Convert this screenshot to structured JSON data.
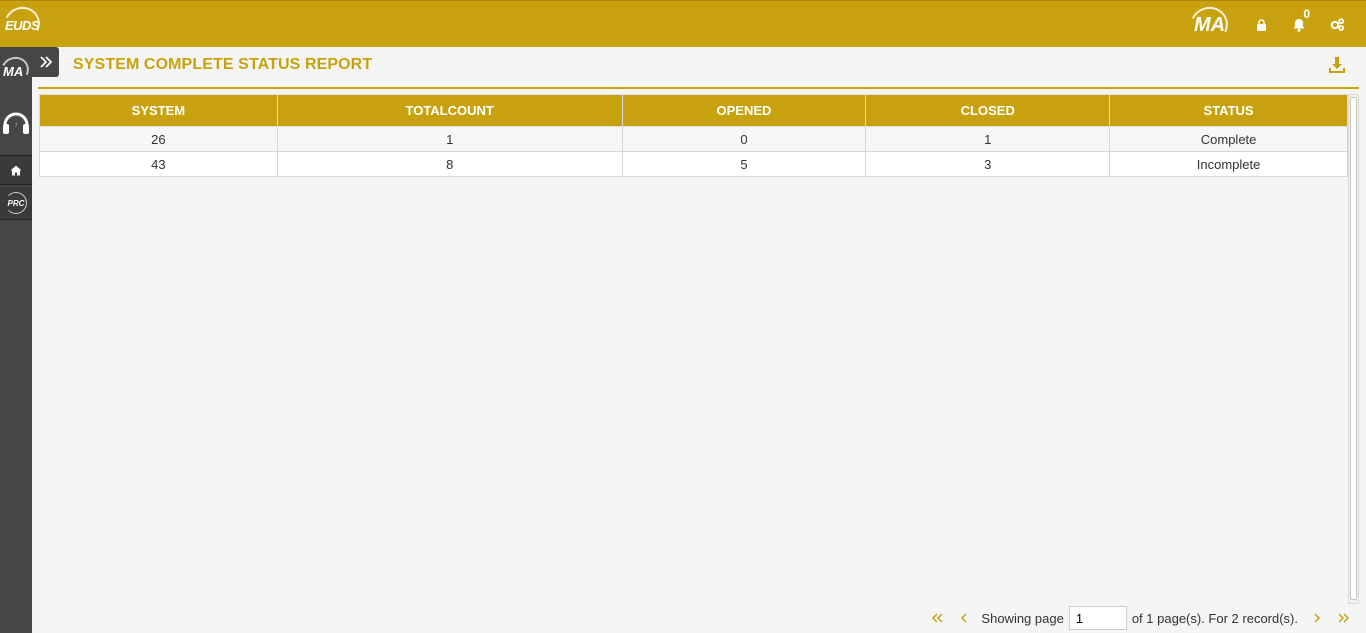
{
  "header": {
    "brand_logo_text": "EUDS",
    "right_logo_text": "MA",
    "notification_count": "0",
    "accent_color": "#c8a20e"
  },
  "sidebar": {
    "logo_text": "MA",
    "prc_logo_text": "PRC",
    "items": [
      {
        "icon": "home-icon"
      }
    ]
  },
  "page": {
    "title": "SYSTEM COMPLETE STATUS REPORT"
  },
  "table": {
    "columns": [
      "SYSTEM",
      "TOTALCOUNT",
      "OPENED",
      "CLOSED",
      "STATUS"
    ],
    "rows": [
      [
        "26",
        "1",
        "0",
        "1",
        "Complete"
      ],
      [
        "43",
        "8",
        "5",
        "3",
        "Incomplete"
      ]
    ]
  },
  "pager": {
    "showing_label": "Showing page",
    "page_value": "1",
    "of_text": "of 1 page(s). For 2 record(s)."
  }
}
